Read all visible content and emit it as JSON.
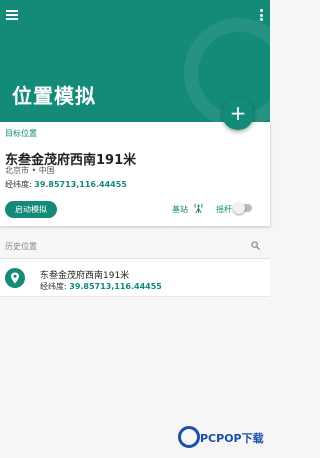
{
  "header": {
    "title": "位置模拟",
    "color": "#148a78"
  },
  "icons": {
    "menu": "menu-icon",
    "more": "more-vert-icon",
    "add": "plus-icon",
    "base_station": "antenna-icon",
    "search": "search-icon",
    "location": "location-pin-icon"
  },
  "fab": {
    "symbol": "+"
  },
  "target": {
    "section_label": "目标位置",
    "name": "东叁金茂府西南191米",
    "city": "北京市 • 中国",
    "coord_label": "经纬度:",
    "coord_value": "39.85713,116.44455",
    "start_button": "启动模拟",
    "base_station_label": "基站",
    "joystick_label": "摇杆",
    "joystick_on": false
  },
  "history": {
    "section_label": "历史位置",
    "items": [
      {
        "name": "东叁金茂府西南191米",
        "coord_label": "经纬度:",
        "coord_value": "39.85713,116.44455"
      }
    ]
  },
  "watermark": {
    "text": "PCPOP下载"
  }
}
